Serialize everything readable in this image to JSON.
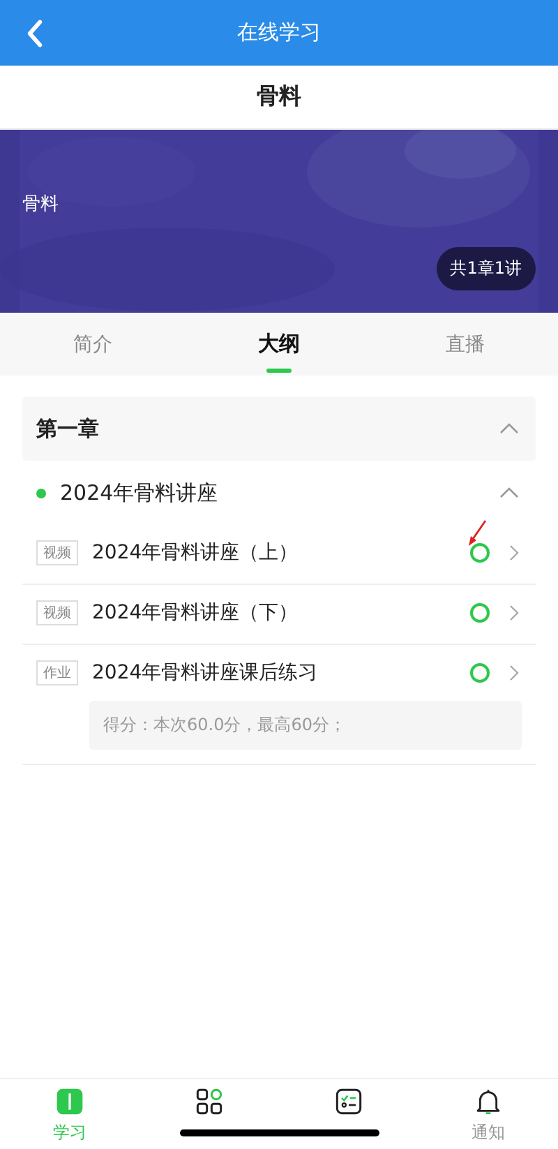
{
  "header": {
    "title": "在线学习"
  },
  "course_title": "骨料",
  "banner": {
    "kind": "picture",
    "caption": "骨料",
    "badge": "共1章1讲"
  },
  "tabs": [
    {
      "label": "简介",
      "selected": false
    },
    {
      "label": "大纲",
      "selected": true
    },
    {
      "label": "直播",
      "selected": false
    }
  ],
  "chapter": {
    "title": "第一章",
    "expanded": true,
    "section": {
      "title": "2024年骨料讲座",
      "expanded": true,
      "color": "#2dc84d",
      "items": [
        {
          "tag": "视频",
          "title": "2024年骨料讲座（上）",
          "annotated": true
        },
        {
          "tag": "视频",
          "title": "2024年骨料讲座（下）",
          "annotated": false
        },
        {
          "tag": "作业",
          "title": "2024年骨料讲座课后练习",
          "annotated": false,
          "score": "得分：本次60.0分，最高60分；"
        }
      ]
    }
  },
  "bottom_nav": [
    {
      "label": "学习",
      "selected": true
    },
    {
      "selected": false
    },
    {
      "selected": false
    },
    {
      "label": "通知",
      "selected": false
    }
  ]
}
